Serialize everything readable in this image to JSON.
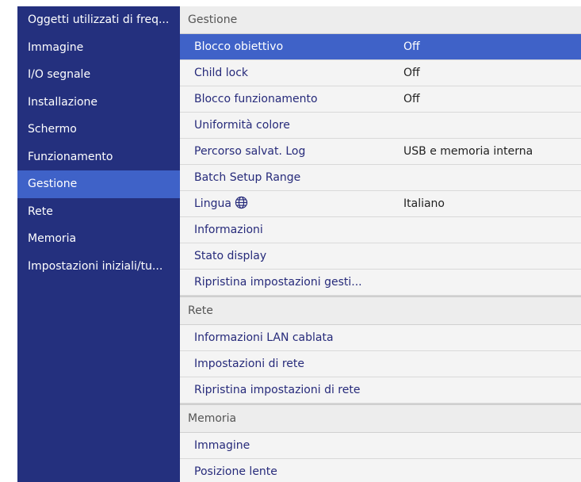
{
  "sidebar": {
    "items": [
      {
        "label": "Oggetti utilizzati di freq...",
        "active": false
      },
      {
        "label": "Immagine",
        "active": false
      },
      {
        "label": "I/O segnale",
        "active": false
      },
      {
        "label": "Installazione",
        "active": false
      },
      {
        "label": "Schermo",
        "active": false
      },
      {
        "label": "Funzionamento",
        "active": false
      },
      {
        "label": "Gestione",
        "active": true
      },
      {
        "label": "Rete",
        "active": false
      },
      {
        "label": "Memoria",
        "active": false
      },
      {
        "label": "Impostazioni iniziali/tu...",
        "active": false
      }
    ]
  },
  "main": {
    "sections": [
      {
        "header": "Gestione",
        "rows": [
          {
            "label": "Blocco obiettivo",
            "value": "Off",
            "selected": true
          },
          {
            "label": "Child lock",
            "value": "Off"
          },
          {
            "label": "Blocco funzionamento",
            "value": "Off"
          },
          {
            "label": "Uniformità colore",
            "value": ""
          },
          {
            "label": "Percorso salvat. Log",
            "value": "USB e memoria interna"
          },
          {
            "label": "Batch Setup Range",
            "value": ""
          },
          {
            "label": "Lingua",
            "value": "Italiano",
            "icon": "globe-icon"
          },
          {
            "label": "Informazioni",
            "value": ""
          },
          {
            "label": "Stato display",
            "value": ""
          },
          {
            "label": "Ripristina impostazioni gesti...",
            "value": ""
          }
        ]
      },
      {
        "header": "Rete",
        "rows": [
          {
            "label": "Informazioni LAN cablata",
            "value": ""
          },
          {
            "label": "Impostazioni di rete",
            "value": ""
          },
          {
            "label": "Ripristina impostazioni di rete",
            "value": ""
          }
        ]
      },
      {
        "header": "Memoria",
        "rows": [
          {
            "label": "Immagine",
            "value": ""
          },
          {
            "label": "Posizione lente",
            "value": ""
          }
        ]
      }
    ]
  },
  "colors": {
    "sidebar_bg": "#24307e",
    "highlight": "#3f62c8",
    "content_bg": "#f4f4f4"
  }
}
